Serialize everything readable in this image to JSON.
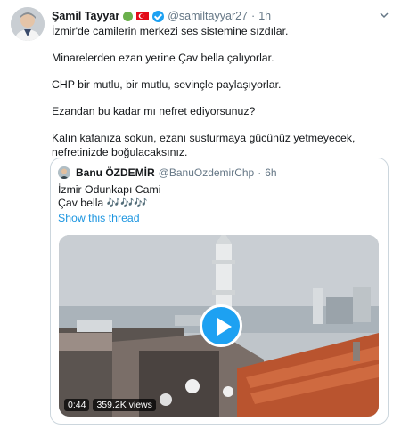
{
  "tweet": {
    "name": "Şamil Tayyar",
    "handle": "@samiltayyar27",
    "separator": "·",
    "time": "1h",
    "lines": [
      "İzmir'de camilerin merkezi ses sistemine sızdılar.",
      "Minarelerden ezan yerine Çav bella çalıyorlar.",
      "CHP bir mutlu, bir mutlu, sevinçle paylaşıyorlar.",
      "Ezandan bu kadar mı nefret ediyorsunuz?",
      "Kalın kafanıza sokun, ezanı susturmaya gücünüz yetmeyecek, nefretinizde boğulacaksınız."
    ],
    "colors": {
      "accent": "#1da1f2",
      "badge_green": "#6ab04c",
      "flag_red": "#e30a17"
    },
    "icons": [
      "green-circle-icon",
      "turkey-flag-icon",
      "verified-icon",
      "chevron-down-icon"
    ]
  },
  "quote": {
    "name": "Banu ÖZDEMİR",
    "handle": "@BanuOzdemirChp",
    "separator": "·",
    "time": "6h",
    "text_line1": "İzmir Odunkapı Cami",
    "text_line2": "Çav bella 🎶🎶🎶",
    "show_thread": "Show this thread",
    "video": {
      "duration": "0:44",
      "views": "359.2K views"
    }
  }
}
